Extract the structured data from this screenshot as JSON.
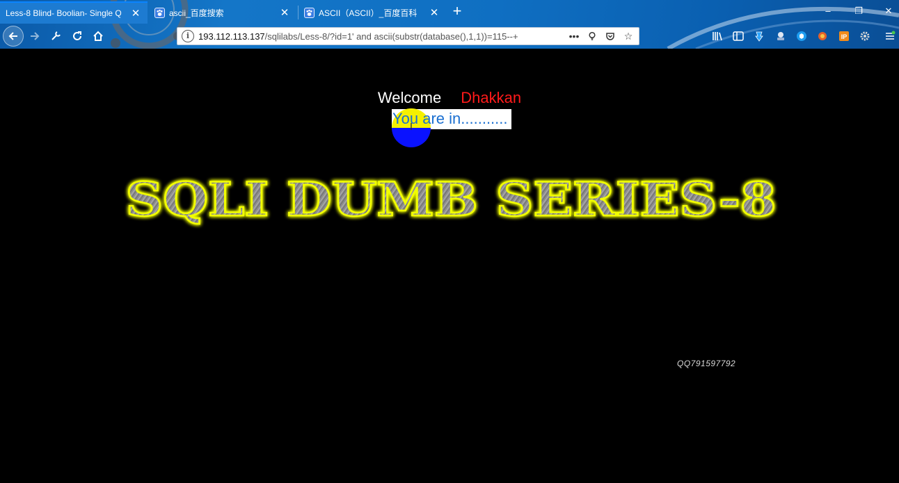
{
  "tabs": [
    {
      "label": "Less-8 Blind- Boolian- Single Q",
      "active": true,
      "favicon": "none"
    },
    {
      "label": "ascii_百度搜索",
      "active": false,
      "favicon": "baidu-paw-icon"
    },
    {
      "label": "ASCII（ASCII）_百度百科",
      "active": false,
      "favicon": "baidu-paw-icon"
    }
  ],
  "window_controls": {
    "minimize": "–",
    "restore": "❐",
    "close": "✕"
  },
  "urlbar": {
    "host": "193.112.113.137",
    "path": "/sqlilabs/Less-8/?id=1' and ascii(substr(database(),1,1))=115--+"
  },
  "page": {
    "welcome_label": "Welcome",
    "welcome_name": "Dhakkan",
    "result": "You are in...........",
    "banner": "SQLI DUMB SERIES-8",
    "watermark": "QQ791597792"
  },
  "colors": {
    "chrome_blue": "#1476c8",
    "name_red": "#ff1a1a",
    "result_blue": "#1a6fd1",
    "banner_glow": "#f2ff00",
    "circle_yellow": "#f4f000",
    "circle_blue": "#0a12ff"
  }
}
